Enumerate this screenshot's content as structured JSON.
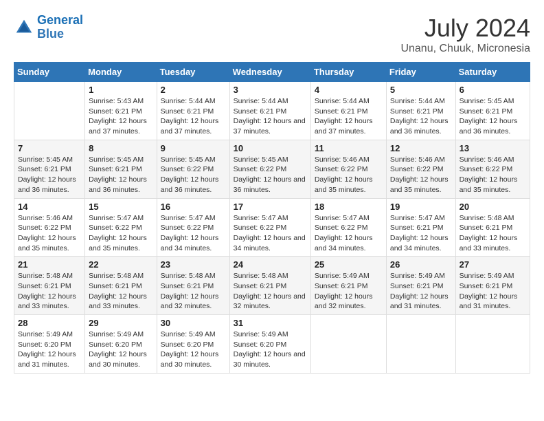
{
  "header": {
    "logo_line1": "General",
    "logo_line2": "Blue",
    "month_year": "July 2024",
    "location": "Unanu, Chuuk, Micronesia"
  },
  "days_of_week": [
    "Sunday",
    "Monday",
    "Tuesday",
    "Wednesday",
    "Thursday",
    "Friday",
    "Saturday"
  ],
  "weeks": [
    [
      {
        "day": "",
        "sunrise": "",
        "sunset": "",
        "daylight": ""
      },
      {
        "day": "1",
        "sunrise": "Sunrise: 5:43 AM",
        "sunset": "Sunset: 6:21 PM",
        "daylight": "Daylight: 12 hours and 37 minutes."
      },
      {
        "day": "2",
        "sunrise": "Sunrise: 5:44 AM",
        "sunset": "Sunset: 6:21 PM",
        "daylight": "Daylight: 12 hours and 37 minutes."
      },
      {
        "day": "3",
        "sunrise": "Sunrise: 5:44 AM",
        "sunset": "Sunset: 6:21 PM",
        "daylight": "Daylight: 12 hours and 37 minutes."
      },
      {
        "day": "4",
        "sunrise": "Sunrise: 5:44 AM",
        "sunset": "Sunset: 6:21 PM",
        "daylight": "Daylight: 12 hours and 37 minutes."
      },
      {
        "day": "5",
        "sunrise": "Sunrise: 5:44 AM",
        "sunset": "Sunset: 6:21 PM",
        "daylight": "Daylight: 12 hours and 36 minutes."
      },
      {
        "day": "6",
        "sunrise": "Sunrise: 5:45 AM",
        "sunset": "Sunset: 6:21 PM",
        "daylight": "Daylight: 12 hours and 36 minutes."
      }
    ],
    [
      {
        "day": "7",
        "sunrise": "Sunrise: 5:45 AM",
        "sunset": "Sunset: 6:21 PM",
        "daylight": "Daylight: 12 hours and 36 minutes."
      },
      {
        "day": "8",
        "sunrise": "Sunrise: 5:45 AM",
        "sunset": "Sunset: 6:21 PM",
        "daylight": "Daylight: 12 hours and 36 minutes."
      },
      {
        "day": "9",
        "sunrise": "Sunrise: 5:45 AM",
        "sunset": "Sunset: 6:22 PM",
        "daylight": "Daylight: 12 hours and 36 minutes."
      },
      {
        "day": "10",
        "sunrise": "Sunrise: 5:45 AM",
        "sunset": "Sunset: 6:22 PM",
        "daylight": "Daylight: 12 hours and 36 minutes."
      },
      {
        "day": "11",
        "sunrise": "Sunrise: 5:46 AM",
        "sunset": "Sunset: 6:22 PM",
        "daylight": "Daylight: 12 hours and 35 minutes."
      },
      {
        "day": "12",
        "sunrise": "Sunrise: 5:46 AM",
        "sunset": "Sunset: 6:22 PM",
        "daylight": "Daylight: 12 hours and 35 minutes."
      },
      {
        "day": "13",
        "sunrise": "Sunrise: 5:46 AM",
        "sunset": "Sunset: 6:22 PM",
        "daylight": "Daylight: 12 hours and 35 minutes."
      }
    ],
    [
      {
        "day": "14",
        "sunrise": "Sunrise: 5:46 AM",
        "sunset": "Sunset: 6:22 PM",
        "daylight": "Daylight: 12 hours and 35 minutes."
      },
      {
        "day": "15",
        "sunrise": "Sunrise: 5:47 AM",
        "sunset": "Sunset: 6:22 PM",
        "daylight": "Daylight: 12 hours and 35 minutes."
      },
      {
        "day": "16",
        "sunrise": "Sunrise: 5:47 AM",
        "sunset": "Sunset: 6:22 PM",
        "daylight": "Daylight: 12 hours and 34 minutes."
      },
      {
        "day": "17",
        "sunrise": "Sunrise: 5:47 AM",
        "sunset": "Sunset: 6:22 PM",
        "daylight": "Daylight: 12 hours and 34 minutes."
      },
      {
        "day": "18",
        "sunrise": "Sunrise: 5:47 AM",
        "sunset": "Sunset: 6:22 PM",
        "daylight": "Daylight: 12 hours and 34 minutes."
      },
      {
        "day": "19",
        "sunrise": "Sunrise: 5:47 AM",
        "sunset": "Sunset: 6:21 PM",
        "daylight": "Daylight: 12 hours and 34 minutes."
      },
      {
        "day": "20",
        "sunrise": "Sunrise: 5:48 AM",
        "sunset": "Sunset: 6:21 PM",
        "daylight": "Daylight: 12 hours and 33 minutes."
      }
    ],
    [
      {
        "day": "21",
        "sunrise": "Sunrise: 5:48 AM",
        "sunset": "Sunset: 6:21 PM",
        "daylight": "Daylight: 12 hours and 33 minutes."
      },
      {
        "day": "22",
        "sunrise": "Sunrise: 5:48 AM",
        "sunset": "Sunset: 6:21 PM",
        "daylight": "Daylight: 12 hours and 33 minutes."
      },
      {
        "day": "23",
        "sunrise": "Sunrise: 5:48 AM",
        "sunset": "Sunset: 6:21 PM",
        "daylight": "Daylight: 12 hours and 32 minutes."
      },
      {
        "day": "24",
        "sunrise": "Sunrise: 5:48 AM",
        "sunset": "Sunset: 6:21 PM",
        "daylight": "Daylight: 12 hours and 32 minutes."
      },
      {
        "day": "25",
        "sunrise": "Sunrise: 5:49 AM",
        "sunset": "Sunset: 6:21 PM",
        "daylight": "Daylight: 12 hours and 32 minutes."
      },
      {
        "day": "26",
        "sunrise": "Sunrise: 5:49 AM",
        "sunset": "Sunset: 6:21 PM",
        "daylight": "Daylight: 12 hours and 31 minutes."
      },
      {
        "day": "27",
        "sunrise": "Sunrise: 5:49 AM",
        "sunset": "Sunset: 6:21 PM",
        "daylight": "Daylight: 12 hours and 31 minutes."
      }
    ],
    [
      {
        "day": "28",
        "sunrise": "Sunrise: 5:49 AM",
        "sunset": "Sunset: 6:20 PM",
        "daylight": "Daylight: 12 hours and 31 minutes."
      },
      {
        "day": "29",
        "sunrise": "Sunrise: 5:49 AM",
        "sunset": "Sunset: 6:20 PM",
        "daylight": "Daylight: 12 hours and 30 minutes."
      },
      {
        "day": "30",
        "sunrise": "Sunrise: 5:49 AM",
        "sunset": "Sunset: 6:20 PM",
        "daylight": "Daylight: 12 hours and 30 minutes."
      },
      {
        "day": "31",
        "sunrise": "Sunrise: 5:49 AM",
        "sunset": "Sunset: 6:20 PM",
        "daylight": "Daylight: 12 hours and 30 minutes."
      },
      {
        "day": "",
        "sunrise": "",
        "sunset": "",
        "daylight": ""
      },
      {
        "day": "",
        "sunrise": "",
        "sunset": "",
        "daylight": ""
      },
      {
        "day": "",
        "sunrise": "",
        "sunset": "",
        "daylight": ""
      }
    ]
  ]
}
